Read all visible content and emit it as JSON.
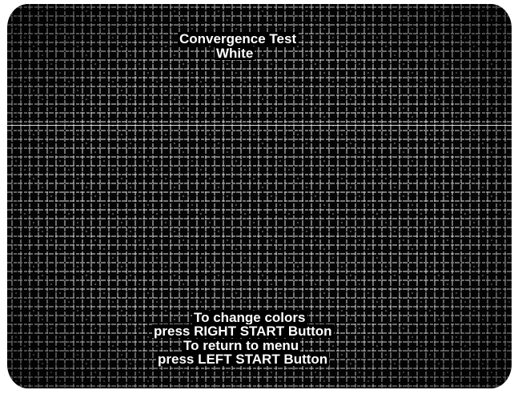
{
  "screen": {
    "title": "Convergence Test",
    "color_name": "White",
    "instructions": [
      "To change colors",
      "press RIGHT START Button",
      "To return to menu",
      "press LEFT START Button"
    ]
  },
  "colors": {
    "background": "#050505",
    "grid_line": "#e8e8e8",
    "text": "#ffffff"
  }
}
